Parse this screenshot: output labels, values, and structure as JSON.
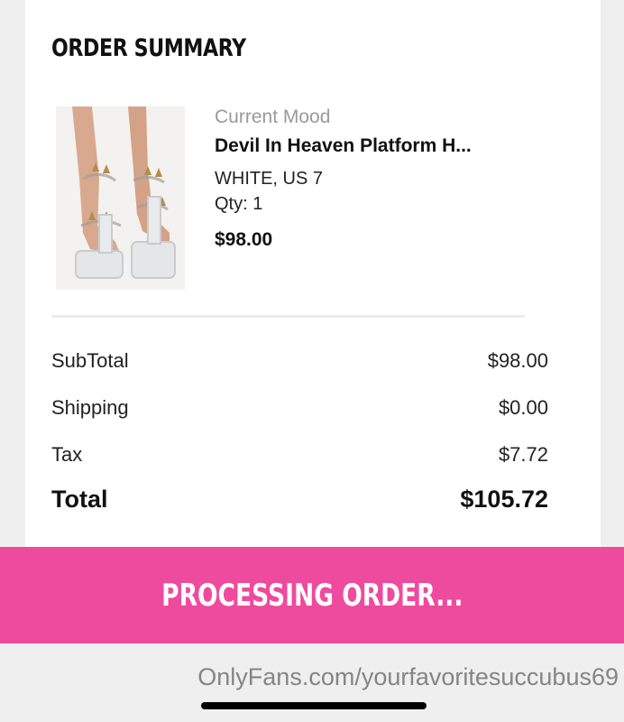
{
  "summary": {
    "title": "ORDER SUMMARY"
  },
  "product": {
    "image_alt": "clear platform heels with spikes",
    "brand": "Current Mood",
    "name": "Devil In Heaven Platform H...",
    "variant": "WHITE, US 7",
    "quantity": "Qty: 1",
    "price": "$98.00"
  },
  "totals": {
    "subtotal_label": "SubTotal",
    "subtotal_value": "$98.00",
    "shipping_label": "Shipping",
    "shipping_value": "$0.00",
    "tax_label": "Tax",
    "tax_value": "$7.72",
    "total_label": "Total",
    "total_value": "$105.72"
  },
  "action": {
    "processing_label": "PROCESSING ORDER..."
  },
  "watermark": "OnlyFans.com/yourfavoritesuccubus69",
  "colors": {
    "accent_pink": "#ee4a9e",
    "card_background": "#ffffff",
    "page_background": "#efefef",
    "muted_text": "#9a9a9a"
  }
}
